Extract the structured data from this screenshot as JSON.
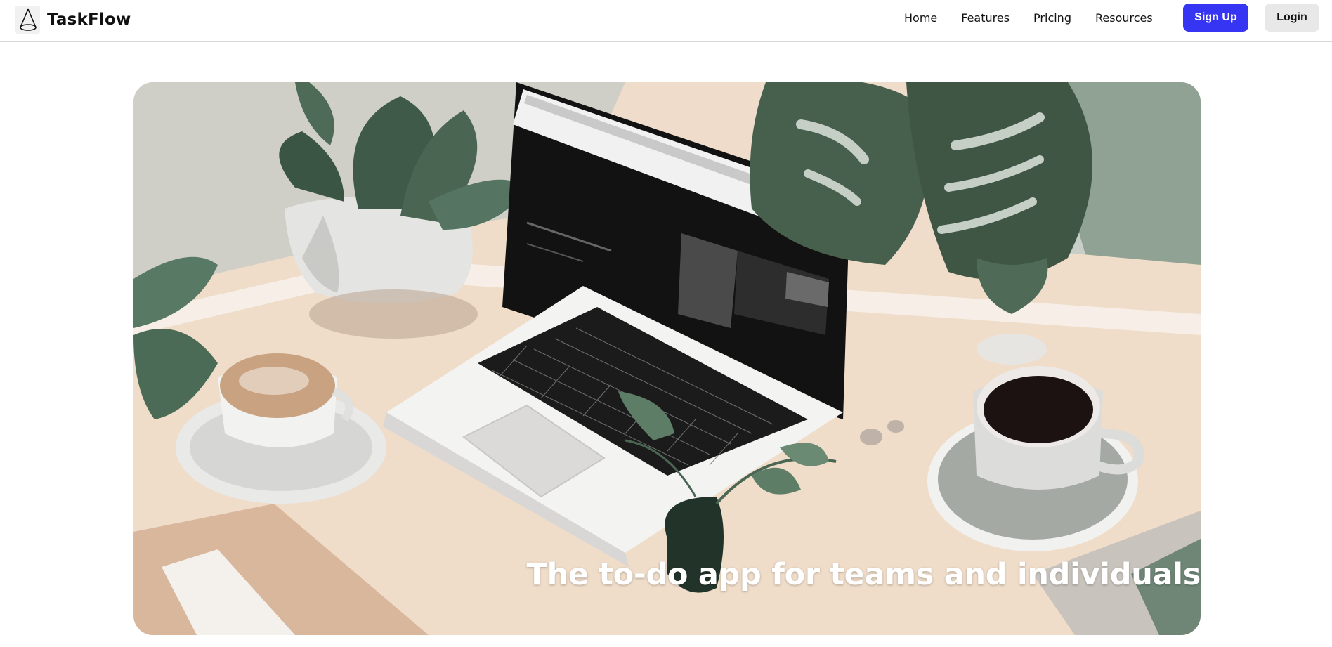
{
  "brand": {
    "name": "TaskFlow",
    "logo_icon": "cone-logo-icon"
  },
  "nav": {
    "links": [
      {
        "label": "Home"
      },
      {
        "label": "Features"
      },
      {
        "label": "Pricing"
      },
      {
        "label": "Resources"
      }
    ],
    "signup_label": "Sign Up",
    "login_label": "Login"
  },
  "hero": {
    "headline": "The to-do app for teams and individuals",
    "image_subject": "illustration-laptop-coffee-plants"
  },
  "colors": {
    "accent": "#3535f3",
    "login_bg": "#e8e8e8",
    "divider": "#d6d6d6"
  }
}
